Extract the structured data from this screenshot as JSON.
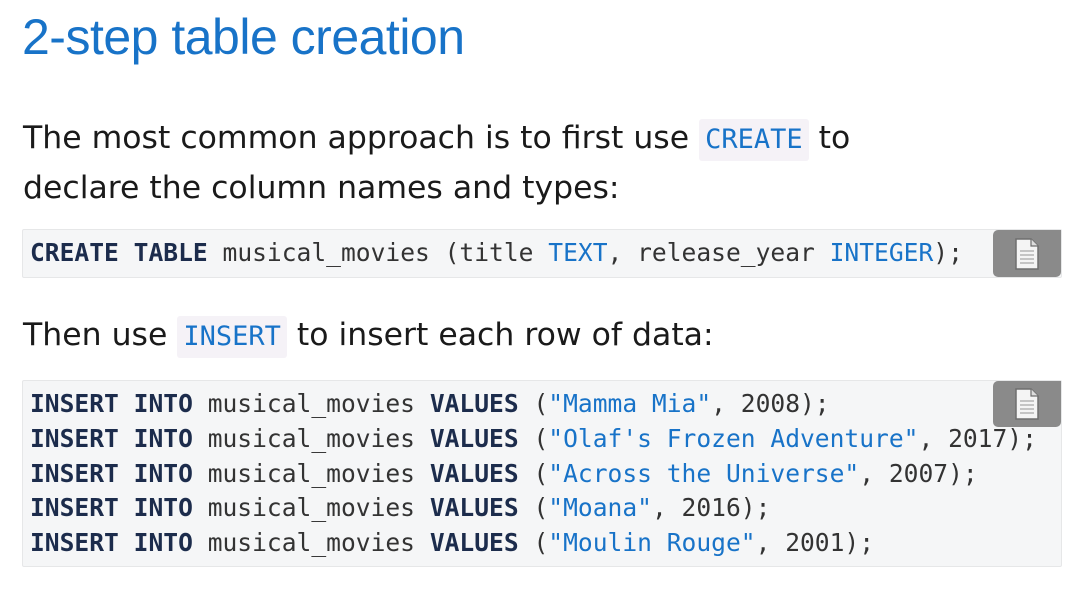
{
  "page": {
    "title": "2-step table creation"
  },
  "intro": {
    "before": "The most common approach is to first use ",
    "code": "CREATE",
    "after": " to",
    "line2": "declare the column names and types:"
  },
  "create_block": {
    "kw_create": "CREATE",
    "kw_table": "TABLE",
    "table_name": " musical_movies ",
    "open": "(title ",
    "type_text": "TEXT",
    "middle": ", release_year ",
    "type_integer": "INTEGER",
    "close": ");"
  },
  "insert_intro": {
    "before": "Then use ",
    "code": "INSERT",
    "after": " to insert each row of data:"
  },
  "insert_block": {
    "kw_insert": "INSERT",
    "kw_into": "INTO",
    "table_name": " musical_movies ",
    "kw_values": "VALUES",
    "rows": [
      {
        "open": " (",
        "title": "\"Mamma Mia\"",
        "rest": ", 2008);"
      },
      {
        "open": " (",
        "title": "\"Olaf's Frozen Adventure\"",
        "rest": ", 2017);"
      },
      {
        "open": " (",
        "title": "\"Across the Universe\"",
        "rest": ", 2007);"
      },
      {
        "open": " (",
        "title": "\"Moana\"",
        "rest": ", 2016);"
      },
      {
        "open": " (",
        "title": "\"Moulin Rouge\"",
        "rest": ", 2001);"
      }
    ]
  },
  "icons": {
    "copy": "copy-document-icon"
  },
  "colors": {
    "accent": "#1873c8",
    "keyword": "#1c2c4c",
    "code_bg": "#f5f6f7",
    "copy_button_bg": "#8a8a8a"
  }
}
